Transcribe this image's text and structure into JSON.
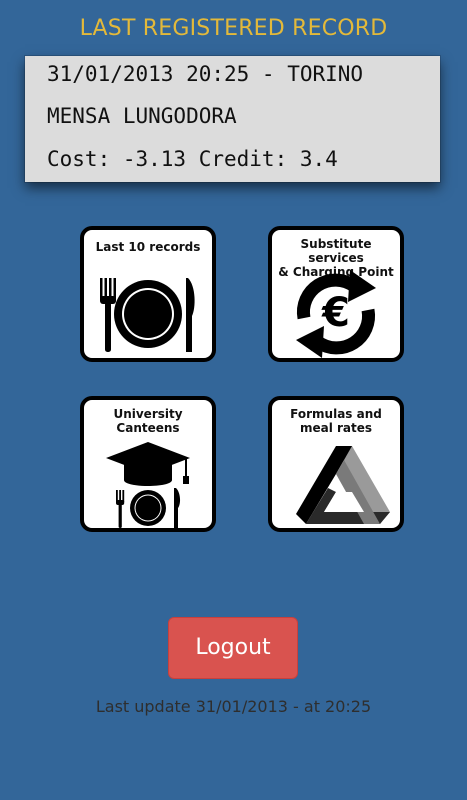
{
  "header": {
    "title": "LAST REGISTERED RECORD"
  },
  "record": {
    "line1": "31/01/2013 20:25 - TORINO",
    "line2": "MENSA LUNGODORA",
    "line3": "Cost: -3.13 Credit: 3.4"
  },
  "tiles": [
    {
      "label": "Last 10 records",
      "icon": "plate-cutlery-icon"
    },
    {
      "label": "Substitute services\n& Charging Point",
      "icon": "euro-recharge-icon"
    },
    {
      "label": "University\nCanteens",
      "icon": "graduation-cap-plate-icon"
    },
    {
      "label": "Formulas and\nmeal rates",
      "icon": "impossible-triangle-icon"
    }
  ],
  "actions": {
    "logout_label": "Logout"
  },
  "footer": {
    "last_update": "Last update 31/01/2013 - at 20:25"
  },
  "colors": {
    "background": "#336699",
    "title": "#e3b93a",
    "record_box": "#dcdcdc",
    "logout": "#d9534f"
  }
}
